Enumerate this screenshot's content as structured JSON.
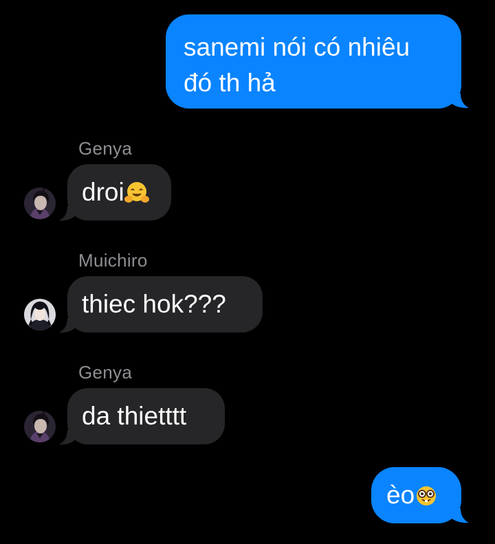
{
  "colors": {
    "background": "#000000",
    "outgoing_bubble": "#0a84ff",
    "incoming_bubble": "#262629",
    "sender_name": "#8e8e93",
    "text": "#ffffff"
  },
  "messages": [
    {
      "direction": "outgoing",
      "lines": [
        "sanemi nói có nhiêu",
        "đó th hả"
      ]
    },
    {
      "direction": "incoming",
      "sender": "Genya",
      "text": "droi",
      "emoji": "hugging-face-emoji",
      "avatar": "genya-avatar"
    },
    {
      "direction": "incoming",
      "sender": "Muichiro",
      "text": "thiec hok???",
      "avatar": "muichiro-avatar"
    },
    {
      "direction": "incoming",
      "sender": "Genya",
      "text": "da thietttt",
      "avatar": "genya-avatar"
    },
    {
      "direction": "outgoing",
      "text": "èo",
      "emoji": "nerd-face-emoji"
    }
  ]
}
